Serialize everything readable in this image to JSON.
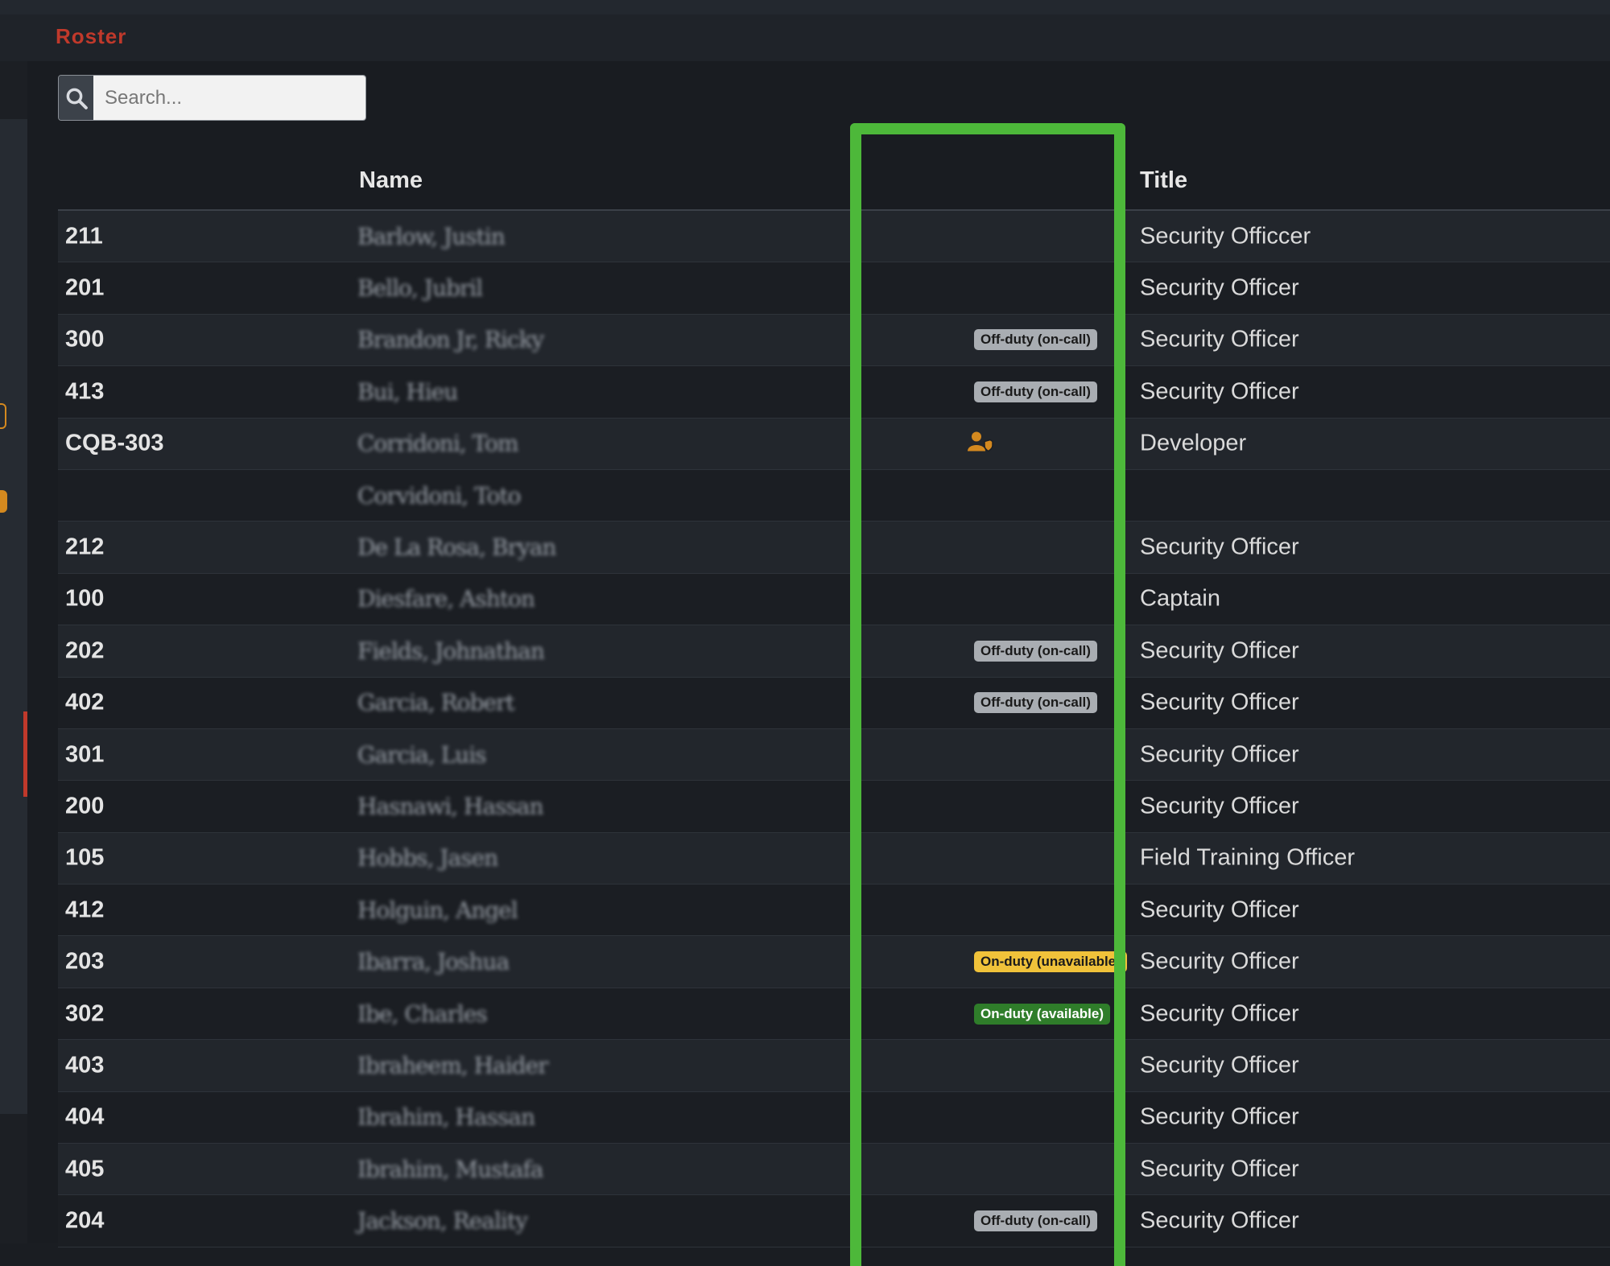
{
  "app": {
    "title": "Roster"
  },
  "search": {
    "placeholder": "Search..."
  },
  "table": {
    "columns": {
      "id": "",
      "name": "Name",
      "status": "",
      "title": "Title"
    },
    "rows": [
      {
        "id": "211",
        "name": "Barlow, Justin",
        "status": "",
        "status_type": "",
        "title": "Security Officcer"
      },
      {
        "id": "201",
        "name": "Bello, Jubril",
        "status": "",
        "status_type": "",
        "title": "Security Officer"
      },
      {
        "id": "300",
        "name": "Brandon Jr, Ricky",
        "status": "Off-duty (on-call)",
        "status_type": "off",
        "title": "Security Officer"
      },
      {
        "id": "413",
        "name": "Bui, Hieu",
        "status": "Off-duty (on-call)",
        "status_type": "off",
        "title": "Security Officer"
      },
      {
        "id": "CQB-303",
        "name": "Corridoni, Tom",
        "status": "",
        "status_type": "icon",
        "title": "Developer"
      },
      {
        "id": "",
        "name": "Corvidoni, Toto",
        "status": "",
        "status_type": "",
        "title": ""
      },
      {
        "id": "212",
        "name": "De La Rosa, Bryan",
        "status": "",
        "status_type": "",
        "title": "Security Officer"
      },
      {
        "id": "100",
        "name": "Diesfare, Ashton",
        "status": "",
        "status_type": "",
        "title": "Captain"
      },
      {
        "id": "202",
        "name": "Fields, Johnathan",
        "status": "Off-duty (on-call)",
        "status_type": "off",
        "title": "Security Officer"
      },
      {
        "id": "402",
        "name": "Garcia, Robert",
        "status": "Off-duty (on-call)",
        "status_type": "off",
        "title": "Security Officer"
      },
      {
        "id": "301",
        "name": "Garcia, Luis",
        "status": "",
        "status_type": "",
        "title": "Security Officer"
      },
      {
        "id": "200",
        "name": "Hasnawi, Hassan",
        "status": "",
        "status_type": "",
        "title": "Security Officer"
      },
      {
        "id": "105",
        "name": "Hobbs, Jasen",
        "status": "",
        "status_type": "",
        "title": "Field Training Officer"
      },
      {
        "id": "412",
        "name": "Holguin, Angel",
        "status": "",
        "status_type": "",
        "title": "Security Officer"
      },
      {
        "id": "203",
        "name": "Ibarra, Joshua",
        "status": "On-duty (unavailable)",
        "status_type": "unavail",
        "title": "Security Officer"
      },
      {
        "id": "302",
        "name": "Ibe, Charles",
        "status": "On-duty (available)",
        "status_type": "avail",
        "title": "Security Officer"
      },
      {
        "id": "403",
        "name": "Ibraheem, Haider",
        "status": "",
        "status_type": "",
        "title": "Security Officer"
      },
      {
        "id": "404",
        "name": "Ibrahim, Hassan",
        "status": "",
        "status_type": "",
        "title": "Security Officer"
      },
      {
        "id": "405",
        "name": "Ibrahim, Mustafa",
        "status": "",
        "status_type": "",
        "title": "Security Officer"
      },
      {
        "id": "204",
        "name": "Jackson, Reality",
        "status": "Off-duty (on-call)",
        "status_type": "off",
        "title": "Security Officer"
      }
    ]
  },
  "colors": {
    "accent": "#c0392b",
    "highlight": "#4db83a",
    "badge_off": "#a9adb2",
    "badge_unavailable": "#f0c23a",
    "badge_available": "#2f7d2a",
    "icon_orange": "#d4891f"
  }
}
